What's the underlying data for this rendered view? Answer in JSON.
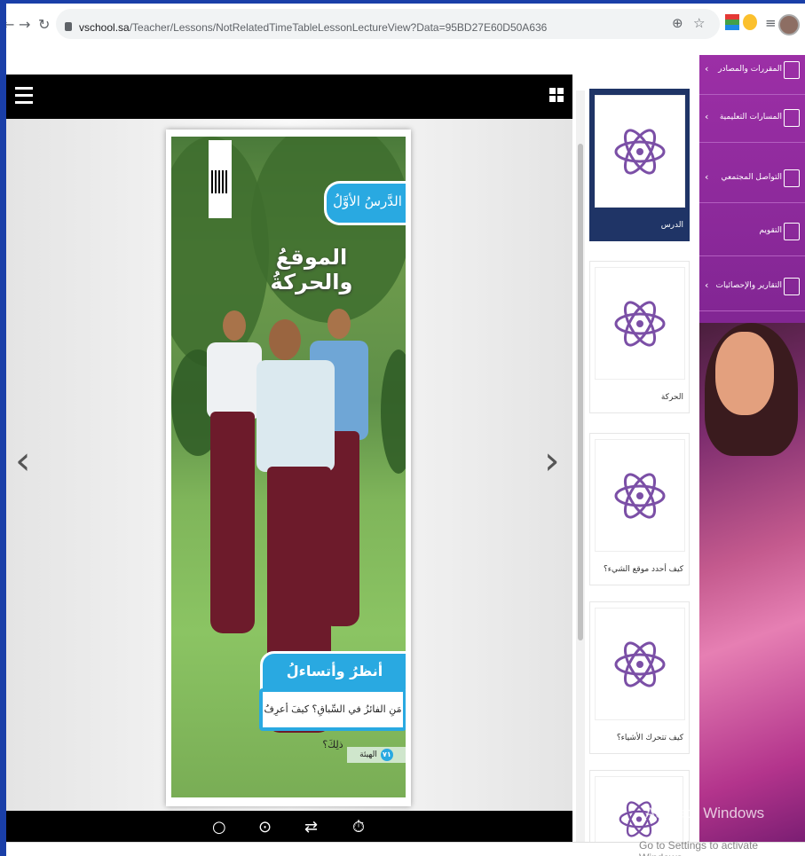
{
  "browser": {
    "url_host": "vschool.sa",
    "url_path": "/Teacher/Lessons/NotRelatedTimeTableLessonLectureView?Data=95BD27E60D50A636"
  },
  "book_page": {
    "lesson_tag": "الدَّرسُ الأوَّلُ",
    "title": "الموقعُ والحركةُ",
    "look_heading": "أنظرُ وأتساءلُ",
    "question": "مَنِ الفائزُ في السِّباقِ؟ كيفَ أعرِفُ ذلِكَ؟",
    "footer_label": "الهيئة",
    "page_number": "٧١"
  },
  "lesson_cards": [
    {
      "label": "الدرس"
    },
    {
      "label": "الحركة"
    },
    {
      "label": "كيف أحدد موقع الشيء؟"
    },
    {
      "label": "كيف تتحرك الأشياء؟"
    },
    {
      "label": ""
    }
  ],
  "nav": {
    "items": [
      {
        "label": "المقررات والمصادر"
      },
      {
        "label": "المسارات التعليمية"
      },
      {
        "label": "التواصل المجتمعي"
      },
      {
        "label": "التقويم"
      },
      {
        "label": "التقارير والإحصائيات"
      }
    ]
  },
  "watermark": {
    "line1": "Activate Windows",
    "line2": "Go to Settings to activate Windows."
  },
  "colors": {
    "nav_purple": "#9c2fa6",
    "active_card": "#1f3466",
    "book_blue": "#29a9e1"
  }
}
